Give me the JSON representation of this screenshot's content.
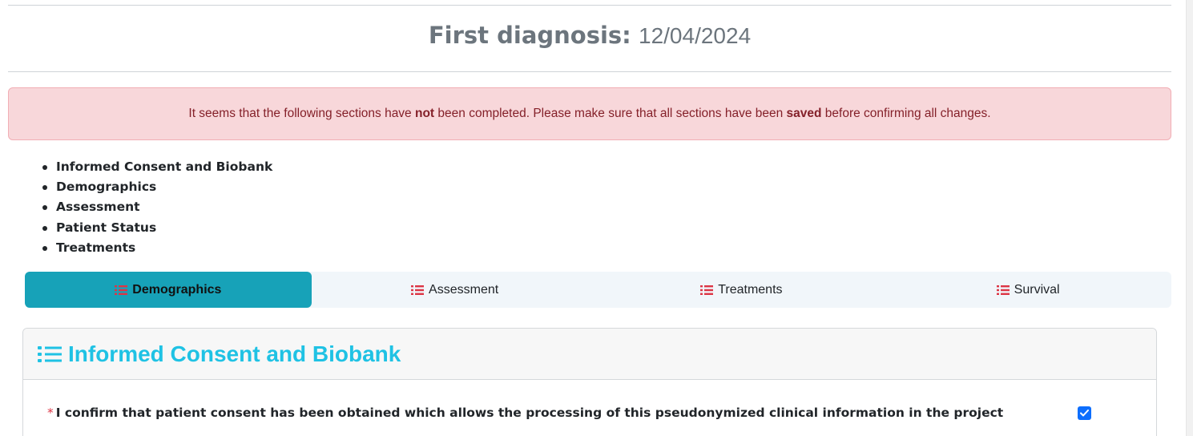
{
  "diagnosis": {
    "label": "First diagnosis:",
    "date": "12/04/2024"
  },
  "alert": {
    "part1": "It seems that the following sections have ",
    "bold1": "not",
    "part2": " been completed. Please make sure that all sections have been ",
    "bold2": "saved",
    "part3": " before confirming all changes."
  },
  "pending_sections": [
    "Informed Consent and Biobank",
    "Demographics",
    "Assessment",
    "Patient Status",
    "Treatments"
  ],
  "tabs": [
    {
      "label": "Demographics",
      "active": true
    },
    {
      "label": "Assessment",
      "active": false
    },
    {
      "label": "Treatments",
      "active": false
    },
    {
      "label": "Survival",
      "active": false
    }
  ],
  "section": {
    "title": "Informed Consent and Biobank",
    "consent_required_mark": "*",
    "consent_text": "I confirm that patient consent has been obtained which allows the processing of this pseudonymized clinical information in the project",
    "consent_checked": true
  },
  "colors": {
    "tab_active": "#17a2b8",
    "icon_red": "#dc3545",
    "section_title": "#1fc2e4",
    "alert_bg": "#f8d7da",
    "alert_text": "#842029",
    "checkbox": "#0d6efd"
  }
}
